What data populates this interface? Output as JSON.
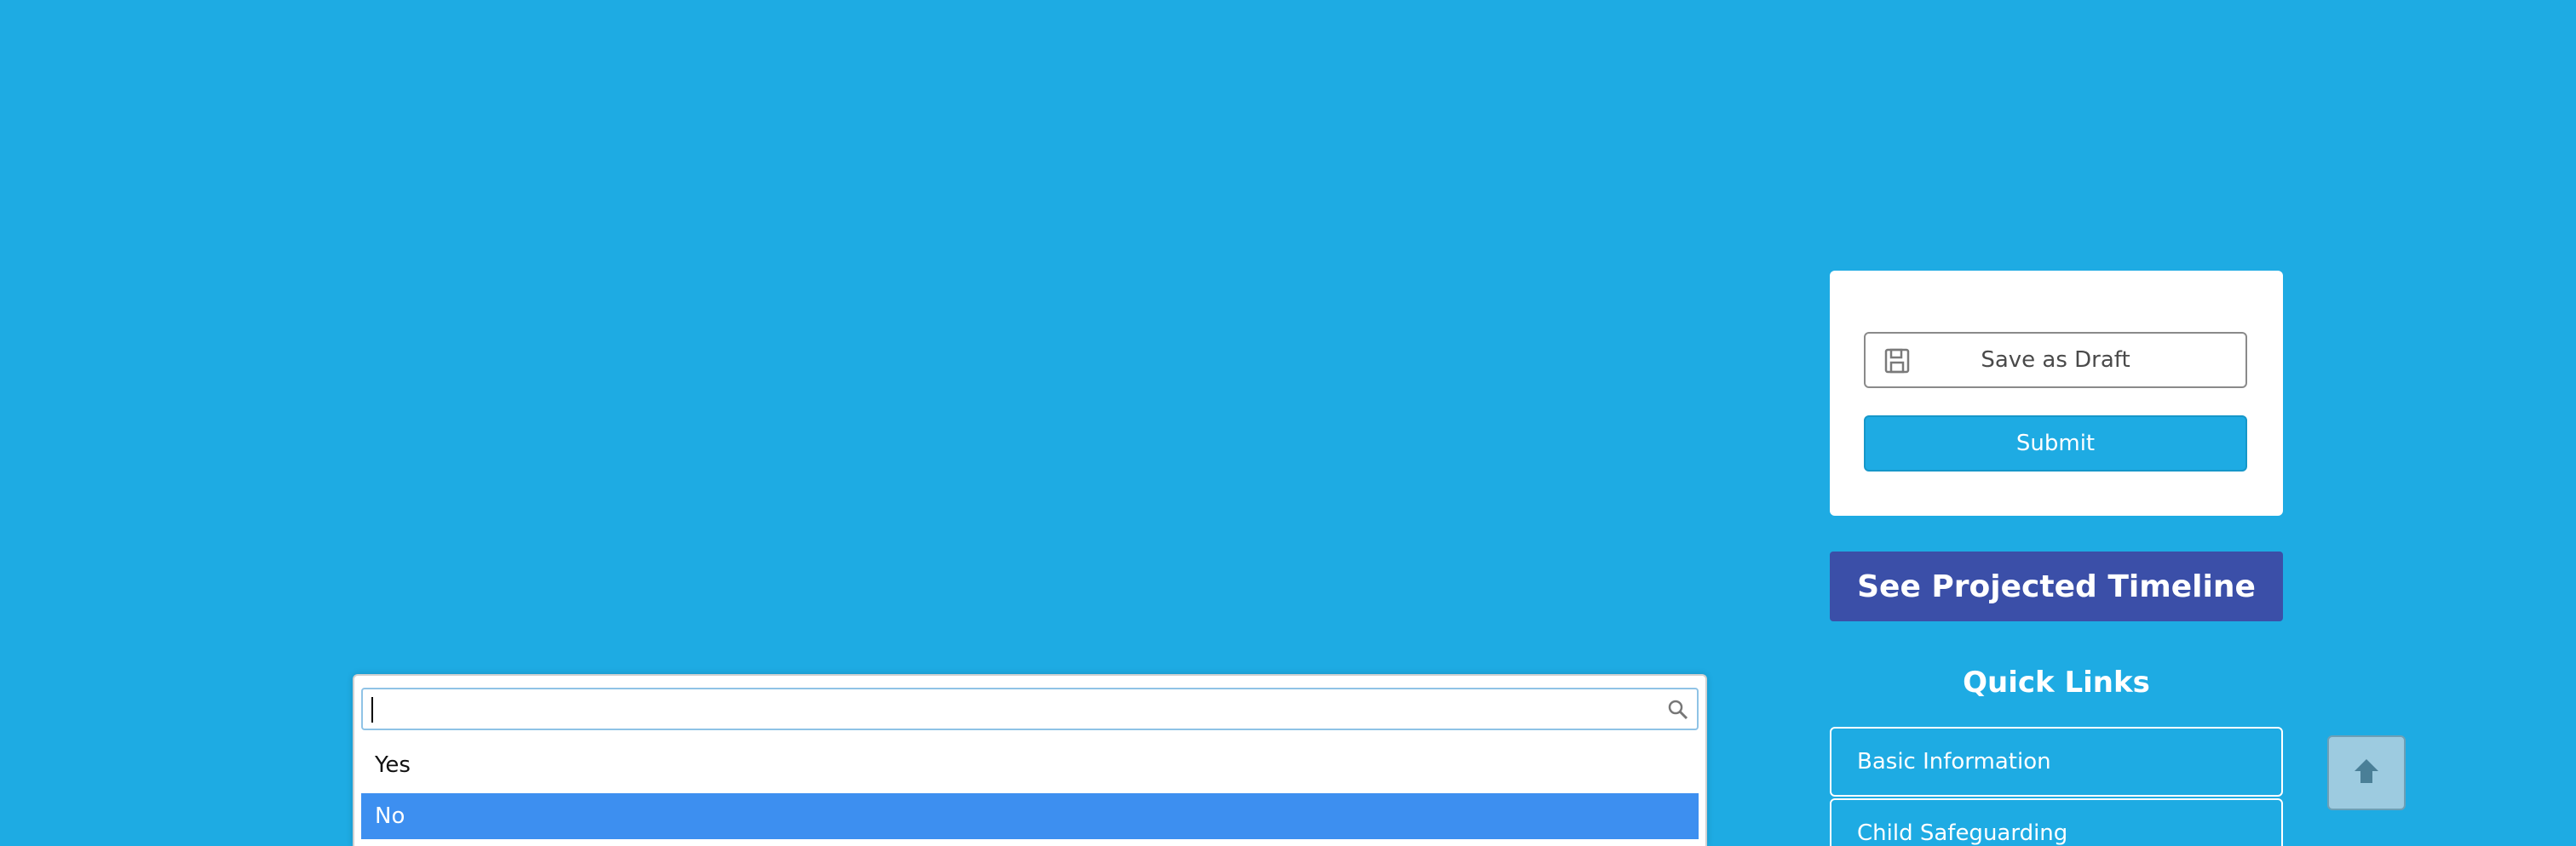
{
  "actions": {
    "save_draft_label": "Save as Draft",
    "submit_label": "Submit"
  },
  "timeline": {
    "label": "See Projected Timeline"
  },
  "quick_links": {
    "heading": "Quick Links",
    "items": [
      {
        "label": "Basic Information"
      },
      {
        "label": "Child Safeguarding"
      }
    ]
  },
  "dropdown": {
    "search_value": "",
    "options": [
      {
        "label": "Yes",
        "highlighted": false
      },
      {
        "label": "No",
        "highlighted": true
      }
    ]
  },
  "colors": {
    "background": "#1eabe3",
    "timeline_button": "#3b4fa8",
    "highlight": "#3d8ff0"
  },
  "icons": [
    "save-icon",
    "search-icon",
    "arrow-up-icon"
  ]
}
